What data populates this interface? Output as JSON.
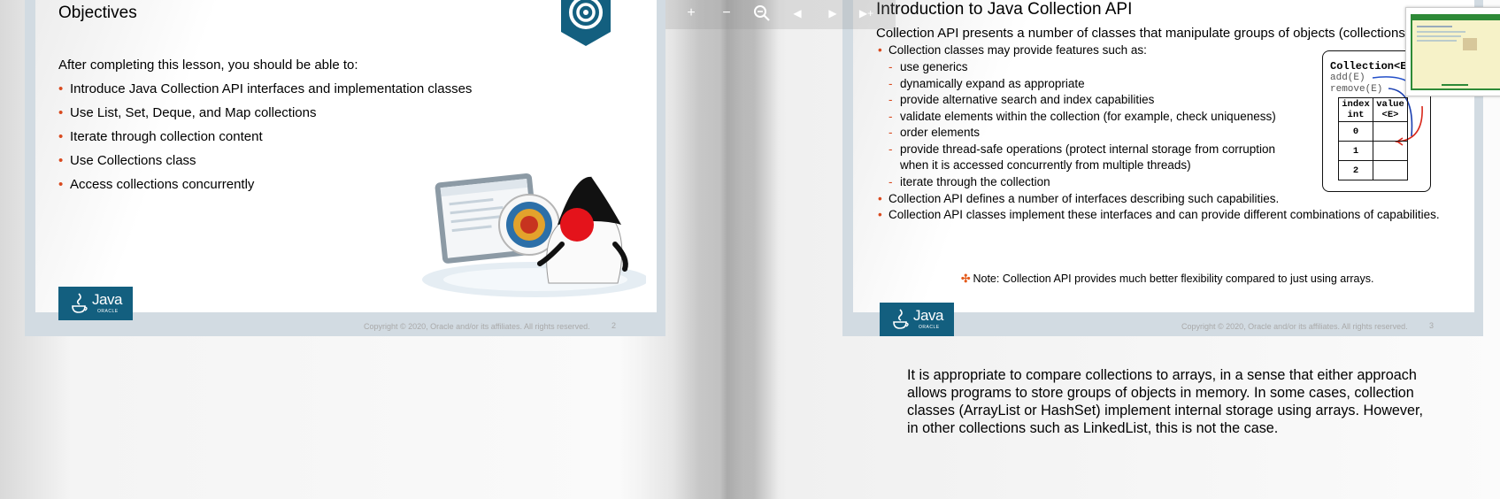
{
  "toolbar": {
    "zoom_in": "+",
    "zoom_out": "−",
    "fit": "fit",
    "prev": "◀",
    "next": "▶",
    "last": "▶+"
  },
  "left_slide": {
    "title": "Objectives",
    "intro": "After completing this lesson, you should be able to:",
    "bullets": [
      "Introduce Java Collection API  interfaces and implementation classes",
      "Use List, Set, Deque, and Map collections",
      "Iterate through collection content",
      "Use Collections class",
      "Access collections concurrently"
    ],
    "copyright": "Copyright © 2020, Oracle and/or its affiliates. All rights reserved.",
    "page_number": "2",
    "logo_word": "Java",
    "logo_sub": "ORACLE"
  },
  "right_slide": {
    "title": "Introduction to Java Collection API",
    "intro": "Collection API presents a number of classes that manipulate groups of objects (collections",
    "bullet1": "Collection classes may provide features such as:",
    "features": [
      "use generics",
      "dynamically expand as appropriate",
      "provide alternative search and index capabilities",
      "validate elements within the collection (for example, check uniqueness)",
      "order elements",
      "provide thread-safe operations (protect internal storage from corruption",
      "iterate through the collection"
    ],
    "feature_cont": "when it is accessed concurrently from multiple threads)",
    "bullet2": "Collection API defines a number of interfaces describing such capabilities.",
    "bullet3": "Collection API classes implement these interfaces and can provide different combinations of capabilities.",
    "note": "Note: Collection API provides much better flexibility compared to just using arrays.",
    "copyright": "Copyright © 2020, Oracle and/or its affiliates. All rights reserved.",
    "page_number": "3",
    "logo_word": "Java",
    "logo_sub": "ORACLE",
    "diagram": {
      "title": "Collection<E",
      "m1": "add(E)",
      "m2": "remove(E)",
      "h1a": "index",
      "h1b": "int",
      "h2a": "value",
      "h2b": "<E>",
      "rows": [
        "0",
        "1",
        "2"
      ]
    }
  },
  "notes_text": "It is appropriate to compare collections to arrays, in a sense that either approach allows programs to store groups of objects in memory. In some cases, collection classes (ArrayList or HashSet) implement internal storage using arrays. However, in other collections such as LinkedList, this is not the case.",
  "colors": {
    "accent": "#d94a1f",
    "java_blue": "#135f7f"
  }
}
